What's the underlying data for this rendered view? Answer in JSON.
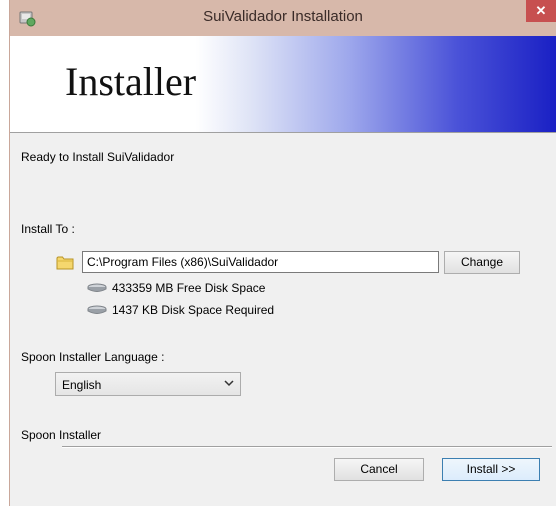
{
  "window": {
    "title": "SuiValidador Installation",
    "close_glyph": "✕",
    "app_icon": "installer-app-icon"
  },
  "banner": {
    "title": "Installer",
    "gradient_colors": [
      "#ffffff",
      "#9ea8ec",
      "#1a20c4"
    ]
  },
  "status_text": "Ready to Install SuiValidador",
  "install": {
    "label": "Install To :",
    "path_value": "C:\\Program Files (x86)\\SuiValidador",
    "change_label": "Change",
    "free_space": "433359 MB Free Disk Space",
    "required_space": "1437 KB Disk Space Required"
  },
  "language": {
    "label": "Spoon Installer Language :",
    "selected": "English"
  },
  "footer": {
    "brand": "Spoon Installer",
    "cancel_label": "Cancel",
    "install_label": "Install >>"
  },
  "colors": {
    "titlebar": "#d7b8aa",
    "close_button": "#c75050",
    "dialog_bg": "#f0f0f0"
  }
}
